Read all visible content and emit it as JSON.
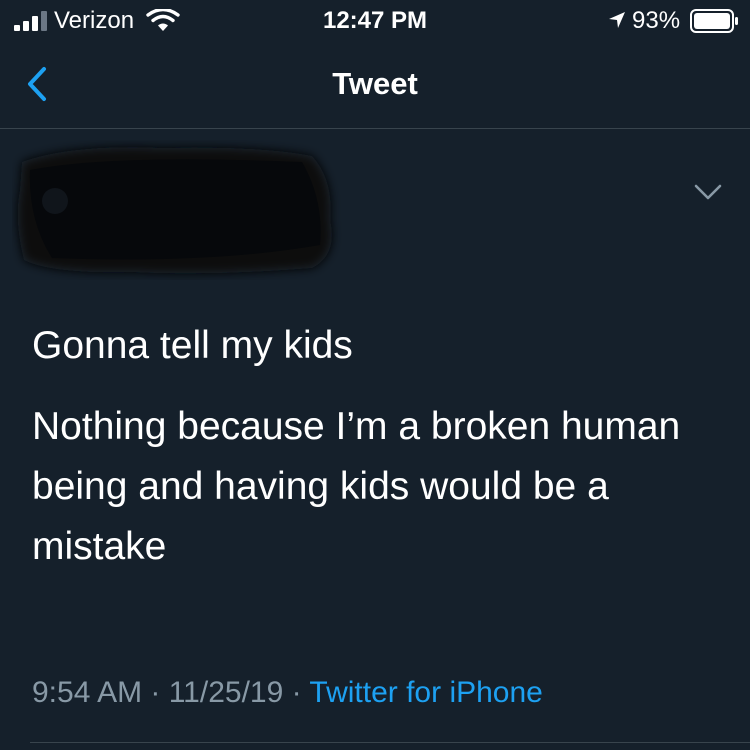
{
  "status_bar": {
    "carrier": "Verizon",
    "time": "12:47 PM",
    "battery_percent": "93%",
    "icons": [
      "signal-icon",
      "wifi-icon",
      "location-icon",
      "battery-icon"
    ]
  },
  "nav": {
    "title": "Tweet",
    "back_icon": "chevron-left-icon"
  },
  "tweet": {
    "line1": "Gonna tell my kids",
    "line2": "Nothing because I’m a broken human being and having kids would be a mistake",
    "date": "9:54 AM · 11/25/19",
    "separator": "·",
    "source": "Twitter for iPhone",
    "more_icon": "chevron-down-icon"
  },
  "colors": {
    "background": "#15202b",
    "text": "#ffffff",
    "secondary_text": "#8899a6",
    "accent": "#1da1f2",
    "divider": "#38444d"
  }
}
